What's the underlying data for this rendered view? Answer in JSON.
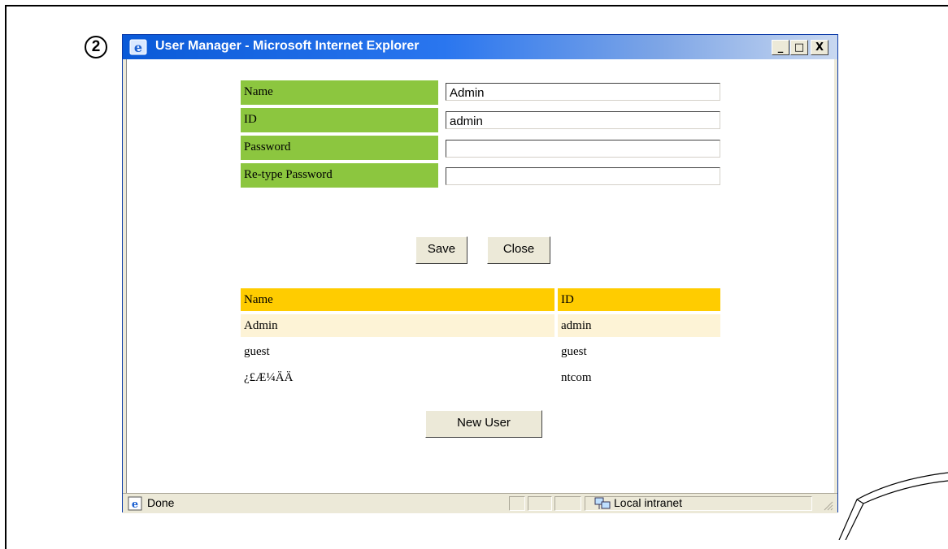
{
  "step_number": "2",
  "window": {
    "title": "User Manager - Microsoft Internet Explorer",
    "minimize": "_",
    "maximize": "□",
    "close": "X"
  },
  "form": {
    "fields": [
      {
        "label": "Name",
        "value": ""
      },
      {
        "label": "ID",
        "value": ""
      },
      {
        "label": "Password",
        "value": ""
      },
      {
        "label": "Re-type Password",
        "value": ""
      }
    ],
    "name_value": "Admin",
    "id_value": "admin",
    "save_label": "Save",
    "close_label": "Close"
  },
  "user_table": {
    "headers": [
      "Name",
      "ID"
    ],
    "rows": [
      {
        "name": "Admin",
        "id": "admin"
      },
      {
        "name": "guest",
        "id": "guest"
      },
      {
        "name": "¿£Æ¼ÄÄ",
        "id": "ntcom"
      }
    ]
  },
  "new_user_label": "New User",
  "status": {
    "text": "Done",
    "zone": "Local intranet"
  },
  "colors": {
    "label_bg": "#8cc63f",
    "header_bg": "#ffcc00",
    "selected_row_bg": "#fdf3d6",
    "titlebar": "#0a5ad8"
  }
}
